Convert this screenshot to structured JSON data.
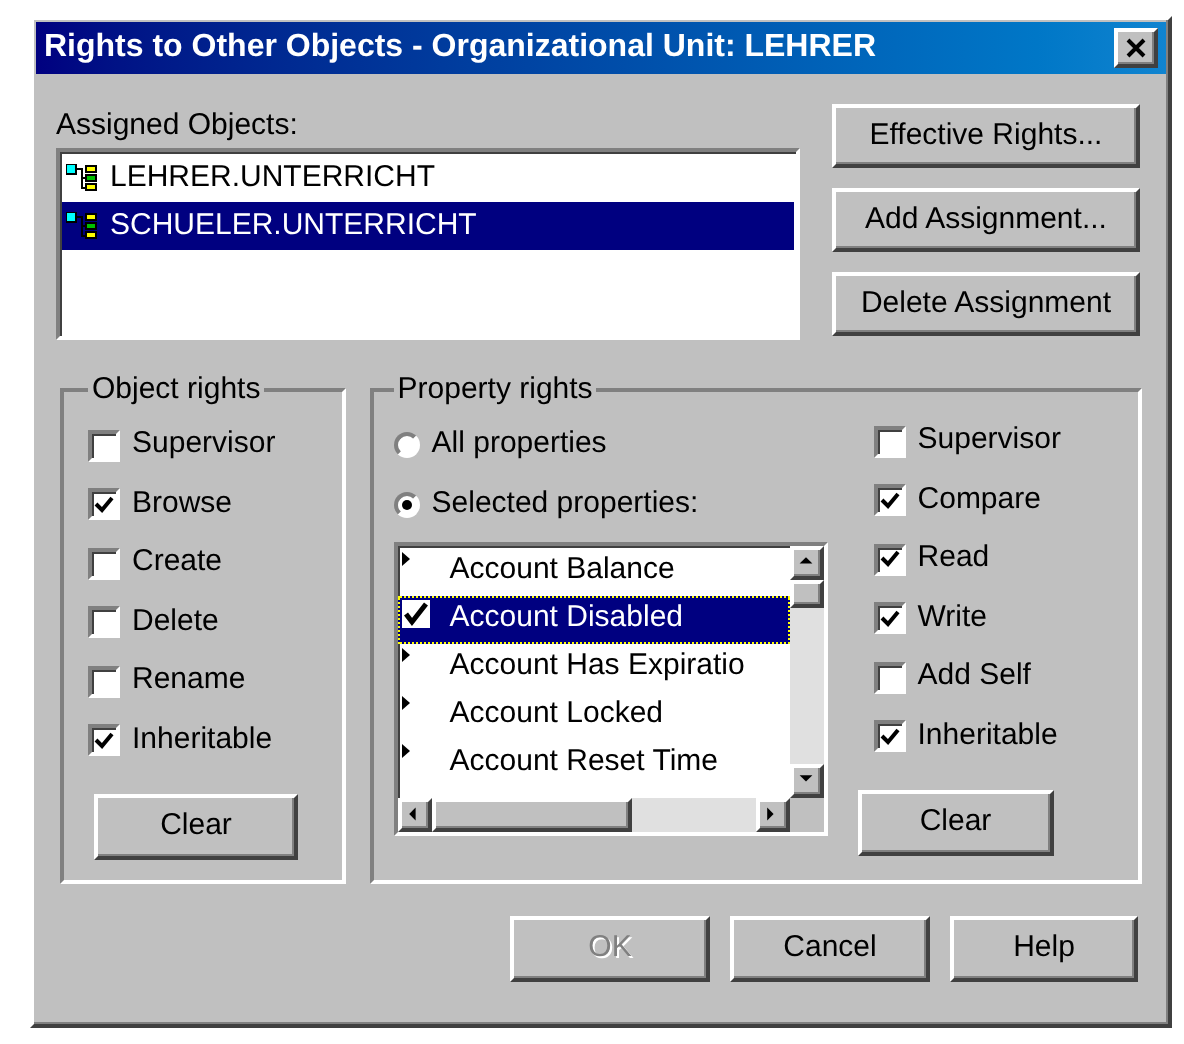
{
  "window": {
    "title": "Rights to Other Objects - Organizational Unit: LEHRER"
  },
  "assigned_objects": {
    "label": "Assigned Objects:",
    "items": [
      {
        "name": "LEHRER.UNTERRICHT",
        "selected": false
      },
      {
        "name": "SCHUELER.UNTERRICHT",
        "selected": true
      }
    ]
  },
  "side_buttons": [
    {
      "label": "Effective Rights...",
      "disabled": false
    },
    {
      "label": "Add Assignment...",
      "disabled": false
    },
    {
      "label": "Delete Assignment",
      "disabled": false
    }
  ],
  "object_rights": {
    "title": "Object rights",
    "options": [
      {
        "label": "Supervisor",
        "checked": false
      },
      {
        "label": "Browse",
        "checked": true
      },
      {
        "label": "Create",
        "checked": false
      },
      {
        "label": "Delete",
        "checked": false
      },
      {
        "label": "Rename",
        "checked": false
      },
      {
        "label": "Inheritable",
        "checked": true
      }
    ],
    "clear": "Clear"
  },
  "property_rights": {
    "title": "Property rights",
    "scope": [
      {
        "label": "All properties",
        "selected": false
      },
      {
        "label": "Selected properties:",
        "selected": true
      }
    ],
    "properties": [
      {
        "name": "Account Balance",
        "checked": false,
        "selected": false
      },
      {
        "name": "Account Disabled",
        "checked": true,
        "selected": true
      },
      {
        "name": "Account Has Expiratio",
        "checked": false,
        "selected": false
      },
      {
        "name": "Account Locked",
        "checked": false,
        "selected": false
      },
      {
        "name": "Account Reset Time",
        "checked": false,
        "selected": false
      }
    ],
    "options": [
      {
        "label": "Supervisor",
        "checked": false
      },
      {
        "label": "Compare",
        "checked": true
      },
      {
        "label": "Read",
        "checked": true
      },
      {
        "label": "Write",
        "checked": true
      },
      {
        "label": "Add Self",
        "checked": false
      },
      {
        "label": "Inheritable",
        "checked": true
      }
    ],
    "clear": "Clear"
  },
  "footer_buttons": [
    {
      "label": "OK",
      "disabled": true
    },
    {
      "label": "Cancel",
      "disabled": false
    },
    {
      "label": "Help",
      "disabled": false
    }
  ]
}
